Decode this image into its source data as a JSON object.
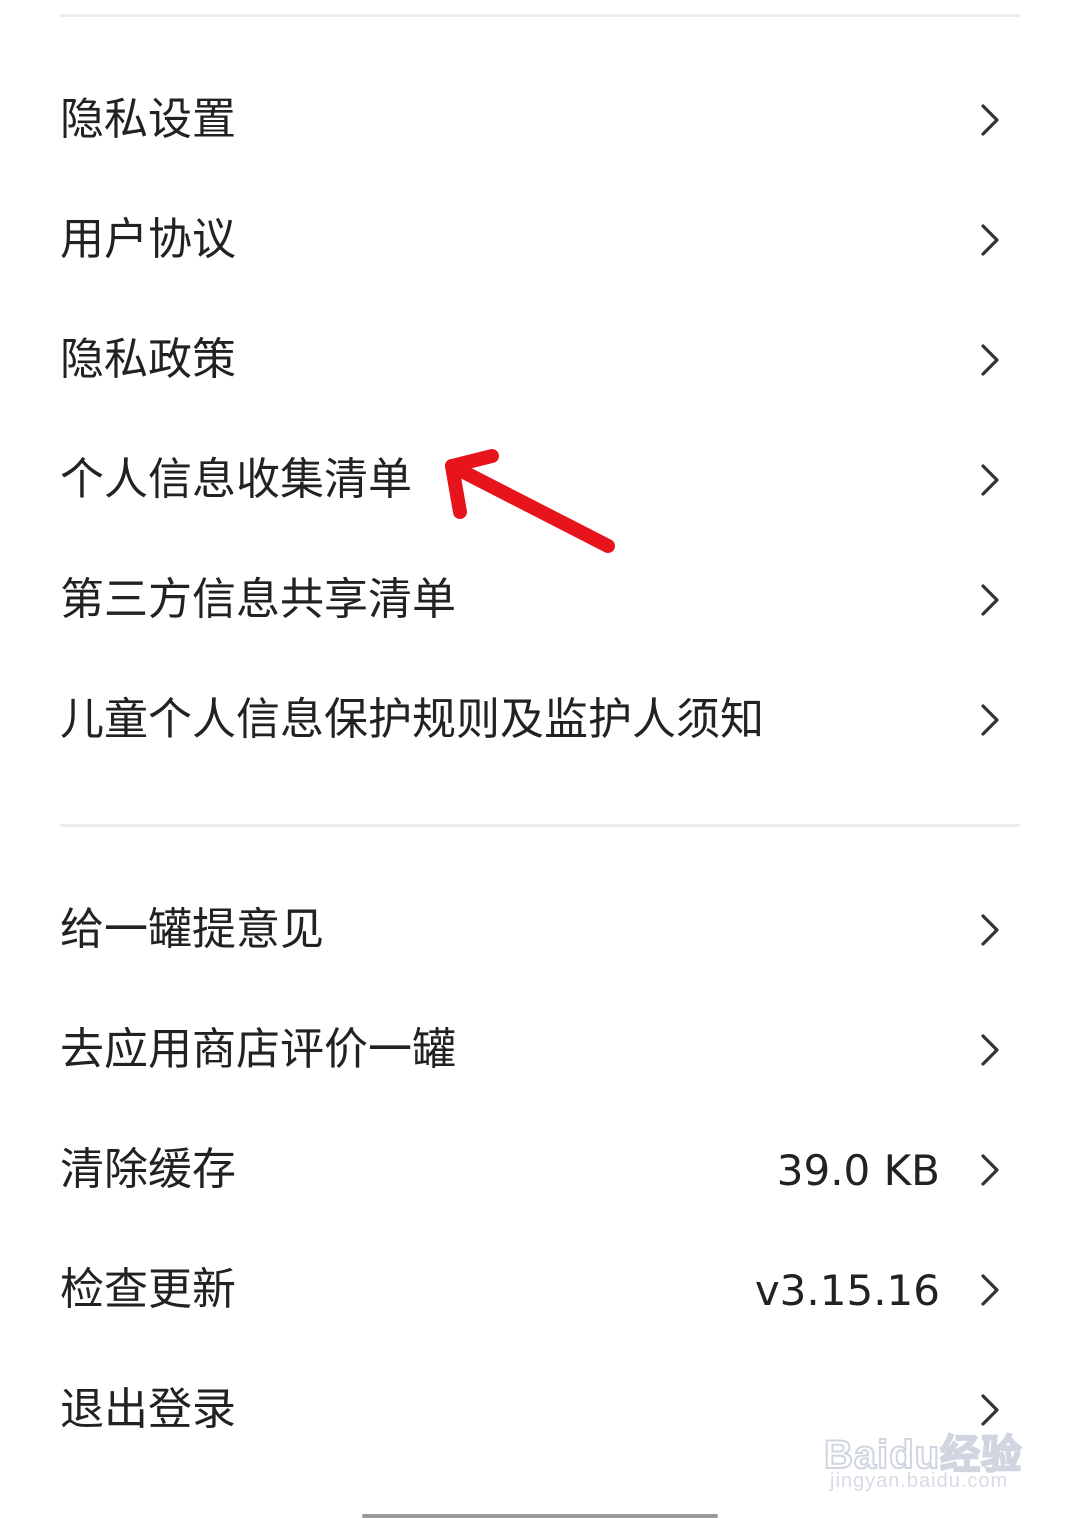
{
  "group1": [
    {
      "label": "隐私设置"
    },
    {
      "label": "用户协议"
    },
    {
      "label": "隐私政策"
    },
    {
      "label": "个人信息收集清单"
    },
    {
      "label": "第三方信息共享清单"
    },
    {
      "label": "儿童个人信息保护规则及监护人须知"
    }
  ],
  "group2": [
    {
      "label": "给一罐提意见"
    },
    {
      "label": "去应用商店评价一罐"
    },
    {
      "label": "清除缓存",
      "value": "39.0 KB"
    },
    {
      "label": "检查更新",
      "value": "v3.15.16"
    },
    {
      "label": "退出登录"
    }
  ],
  "icons": {
    "row_chevron": "chevron-right-icon",
    "annotation": "red-arrow-icon"
  },
  "colors": {
    "annotation_arrow": "#e8141c",
    "divider": "#ececec",
    "text": "#222222"
  },
  "watermark": {
    "brand": "Baidu经验",
    "url": "jingyan.baidu.com"
  }
}
